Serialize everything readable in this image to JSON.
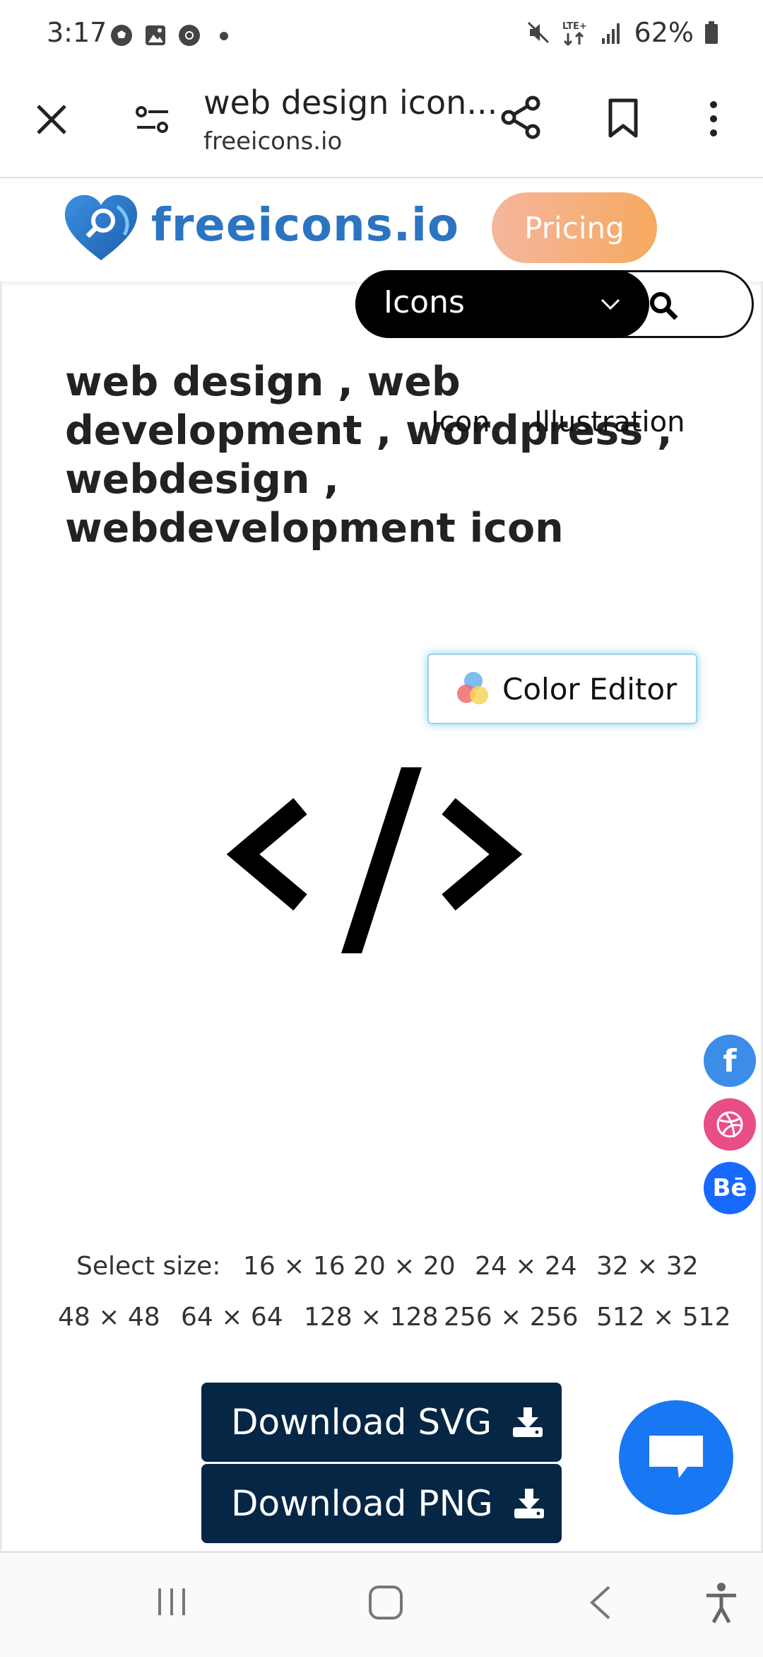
{
  "status_bar": {
    "time": "3:17",
    "battery": "62%",
    "icons": [
      "soccer-icon",
      "image-icon",
      "chrome-icon",
      "dot-icon",
      "mute-icon",
      "lte-icon",
      "signal-icon",
      "battery-icon"
    ]
  },
  "browser": {
    "page_title": "web design icon...",
    "domain": "freeicons.io"
  },
  "site": {
    "logo_text": "freeicons.io",
    "pricing_label": "Pricing",
    "search_category": "Icons",
    "heading": "web design , web development , wordpress , webdesign , webdevelopment icon",
    "tab_icon": "Icon",
    "tab_illustration": "Illustration",
    "color_editor_label": "Color Editor",
    "main_icon": "code-icon",
    "social": {
      "facebook": "f",
      "behance": "Bē"
    },
    "sizes": {
      "label": "Select size:",
      "options": [
        "16 × 16",
        "20 × 20",
        "24 × 24",
        "32 × 32",
        "48 × 48",
        "64 × 64",
        "128 × 128",
        "256 × 256",
        "512 × 512"
      ]
    },
    "download_svg": "Download SVG",
    "download_png": "Download PNG"
  },
  "colors": {
    "brand_blue": "#2b74c2",
    "download_navy": "#062645",
    "chat_blue": "#1877f2",
    "pricing_gradient_start": "#f4b69e",
    "pricing_gradient_end": "#f7a95f"
  }
}
